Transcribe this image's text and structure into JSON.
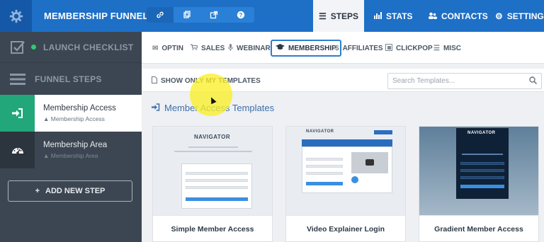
{
  "header": {
    "funnel_title": "MEMBERSHIP FUNNEL ...",
    "nav": [
      {
        "label": "STEPS",
        "icon": "list-icon",
        "active": true
      },
      {
        "label": "STATS",
        "icon": "bar-chart-icon",
        "active": false
      },
      {
        "label": "CONTACTS",
        "icon": "users-icon",
        "active": false
      },
      {
        "label": "SETTINGS",
        "icon": "gear-icon",
        "active": false
      }
    ],
    "tools": [
      "link-icon",
      "copy-icon",
      "external-link-icon",
      "help-icon"
    ]
  },
  "sidebar": {
    "launch_checklist": "LAUNCH CHECKLIST",
    "funnel_steps": "FUNNEL STEPS",
    "steps": [
      {
        "name": "Membership Access",
        "type": "Membership Access",
        "active": true
      },
      {
        "name": "Membership Area",
        "type": "Membership Area",
        "active": false
      }
    ],
    "add_step": "ADD NEW STEP"
  },
  "main": {
    "subtabs": [
      {
        "label": "OPTIN",
        "icon": "envelope-icon",
        "active": false
      },
      {
        "label": "SALES",
        "icon": "cart-icon",
        "active": false
      },
      {
        "label": "WEBINAR",
        "icon": "microphone-icon",
        "active": false
      },
      {
        "label": "MEMBERSHIP",
        "icon": "graduation-cap-icon",
        "active": true
      },
      {
        "label": "AFFILIATES",
        "icon": "dollar-icon",
        "active": false
      },
      {
        "label": "CLICKPOP",
        "icon": "popup-icon",
        "active": false
      },
      {
        "label": "MISC",
        "icon": "list-icon",
        "active": false
      }
    ],
    "filter_label": "SHOW ONLY MY TEMPLATES",
    "search_placeholder": "Search Templates...",
    "section_title": "Member Access Templates",
    "templates": [
      {
        "name": "Simple Member Access",
        "thumb_logo": "NAVIGATOR"
      },
      {
        "name": "Video Explainer Login",
        "thumb_logo": "NAVIGATOR"
      },
      {
        "name": "Gradient Member Access",
        "thumb_logo": "NAVIGATOR"
      }
    ]
  },
  "colors": {
    "topbar": "#1e6fc6",
    "sidebar": "#3c4652",
    "active_step": "#22a77a",
    "highlight": "#faf028"
  }
}
